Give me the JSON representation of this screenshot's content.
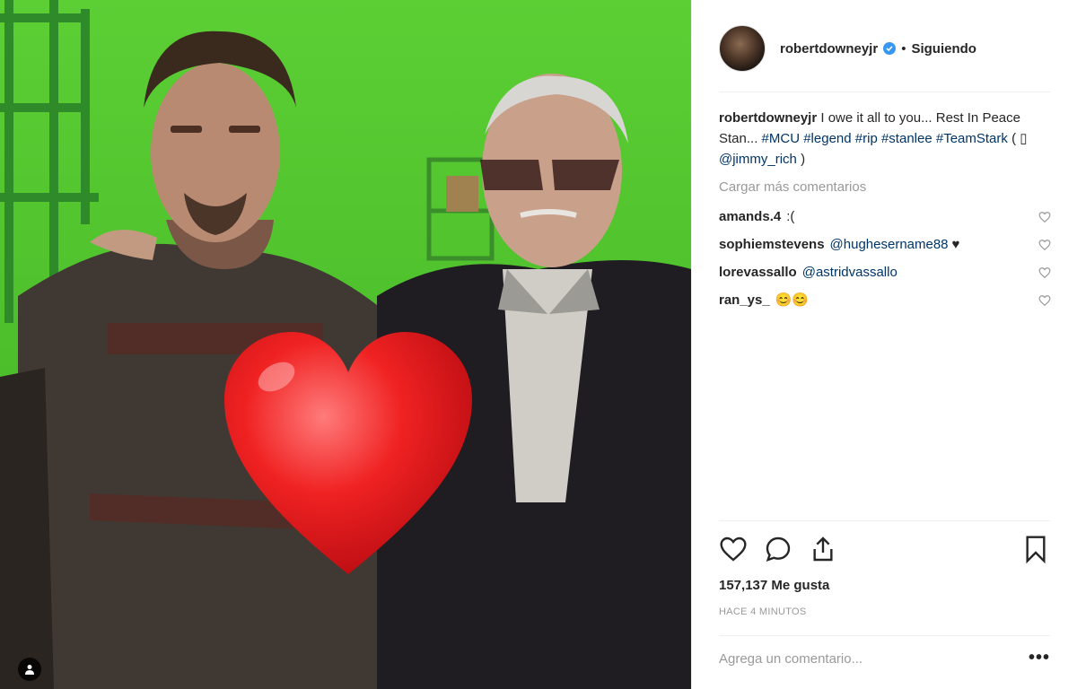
{
  "post": {
    "username": "robertdowneyjr",
    "follow_status": "Siguiendo",
    "separator": "•",
    "caption": {
      "username": "robertdowneyjr",
      "text_1": "I owe it all to you... Rest In Peace Stan...",
      "hashtags": [
        "#MCU",
        "#legend",
        "#rip",
        "#stanlee",
        "#TeamStark"
      ],
      "mention_open": "( ▯ ",
      "mention": "@jimmy_rich",
      "mention_close": " )"
    },
    "load_more": "Cargar más comentarios",
    "comments": [
      {
        "user": "amands.4",
        "text": ":(",
        "is_link": false
      },
      {
        "user": "sophiemstevens",
        "text": "@hughesername88",
        "suffix": "♥",
        "is_link": true
      },
      {
        "user": "lorevassallo",
        "text": "@astridvassallo",
        "is_link": true
      },
      {
        "user": "ran_ys_",
        "text": "😊😊",
        "is_link": false
      }
    ],
    "likes": "157,137 Me gusta",
    "time": "HACE 4 MINUTOS",
    "comment_placeholder": "Agrega un comentario...",
    "more_options": "•••"
  },
  "icons": {
    "verified": "verified-badge-icon",
    "like": "heart-outline-icon",
    "comment": "comment-bubble-icon",
    "share": "share-upload-icon",
    "save": "bookmark-icon",
    "tag": "person-tag-icon",
    "overlay": "red-heart-emoji-icon"
  },
  "colors": {
    "green_screen": "#4fc62a",
    "heart_red": "#e8141c",
    "link_blue": "#003569",
    "verified_blue": "#3897f0",
    "muted_gray": "#999999"
  }
}
